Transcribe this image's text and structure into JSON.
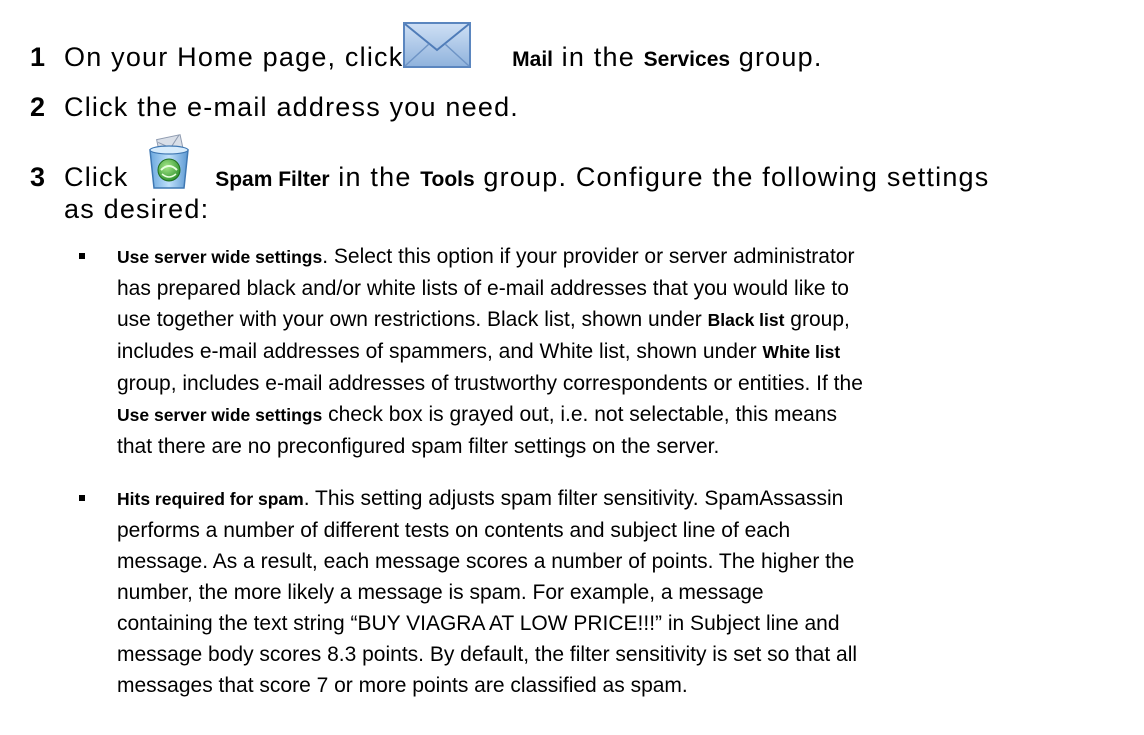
{
  "steps": [
    {
      "number": "1",
      "parts": [
        "On your Home page, click ",
        "Mail",
        " in the ",
        "Services",
        " group."
      ],
      "icon": "envelope-icon"
    },
    {
      "number": "2",
      "text": "Click the e-mail address you need."
    },
    {
      "number": "3",
      "parts": [
        "Click ",
        "Spam Filter",
        " in the ",
        "Tools",
        " group. Configure the following settings"
      ],
      "continuation": "as desired:",
      "icon": "spam-filter-icon"
    }
  ],
  "bullets": [
    {
      "lines": [
        [
          "Use server wide settings",
          ". Select this option if your provider or server administrator"
        ],
        [
          "has prepared black and/or white lists of e-mail addresses that you would like to"
        ],
        [
          "use together with your own restrictions. Black list, shown under ",
          "Black list",
          " group,"
        ],
        [
          "includes e-mail addresses of spammers, and White list, shown under ",
          "White list"
        ],
        [
          "group, includes e-mail addresses of trustworthy correspondents or entities. If the"
        ],
        [
          "Use server wide settings",
          " check box is grayed out, i.e. not selectable, this means"
        ],
        [
          "that there are no preconfigured spam filter settings on the server."
        ]
      ]
    },
    {
      "lines": [
        [
          "Hits required for spam",
          ". This setting adjusts spam filter sensitivity. SpamAssassin"
        ],
        [
          "performs a number of different tests on contents and subject line of each"
        ],
        [
          "message. As a result, each message scores a number of points. The higher the"
        ],
        [
          "number, the more likely a message is spam. For example, a message"
        ],
        [
          "containing the text string “BUY VIAGRA AT LOW PRICE!!!” in Subject line and"
        ],
        [
          "message body scores 8.3 points. By default, the filter sensitivity is set so that all"
        ],
        [
          "messages that score 7 or more points are classified as spam."
        ]
      ]
    }
  ]
}
